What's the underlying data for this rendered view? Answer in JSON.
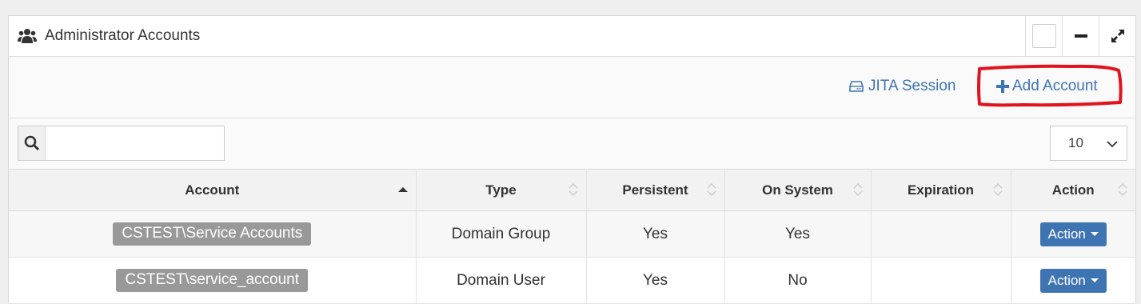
{
  "panel": {
    "title": "Administrator Accounts",
    "header_icons": [
      "users-icon",
      "square-icon",
      "minimize-icon",
      "expand-icon"
    ]
  },
  "toolbar": {
    "jita_label": "JITA Session",
    "jita_icon": "hard-drive-icon",
    "add_label": "Add Account",
    "add_icon": "plus-icon"
  },
  "search": {
    "value": "",
    "placeholder": ""
  },
  "page_size": {
    "selected": "10"
  },
  "table": {
    "headers": [
      "Account",
      "Type",
      "Persistent",
      "On System",
      "Expiration",
      "Action"
    ],
    "rows": [
      {
        "account": "CSTEST\\Service Accounts",
        "type": "Domain Group",
        "persistent": "Yes",
        "on_system": "Yes",
        "expiration": "",
        "action": "Action"
      },
      {
        "account": "CSTEST\\service_account",
        "type": "Domain User",
        "persistent": "Yes",
        "on_system": "No",
        "expiration": "",
        "action": "Action"
      }
    ]
  },
  "colors": {
    "link": "#3f74b3",
    "button": "#3f74b3",
    "badge": "#999999",
    "annotation": "#e0141e"
  }
}
